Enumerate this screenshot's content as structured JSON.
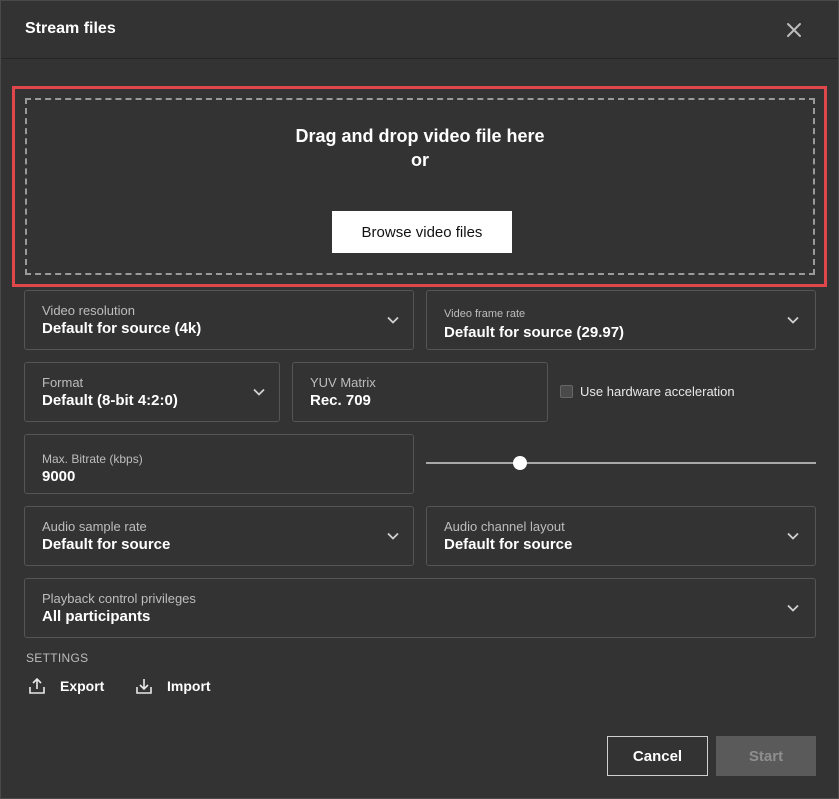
{
  "dialog": {
    "title": "Stream files"
  },
  "dropzone": {
    "main_text": "Drag and drop video file here",
    "or_text": "or",
    "browse_label": "Browse video files"
  },
  "fields": {
    "video_resolution": {
      "label": "Video resolution",
      "value": "Default for source (4k)"
    },
    "video_frame_rate": {
      "label": "Video frame rate",
      "value": "Default for source (29.97)"
    },
    "format": {
      "label": "Format",
      "value": "Default (8-bit 4:2:0)"
    },
    "yuv_matrix": {
      "label": "YUV Matrix",
      "value": "Rec. 709"
    },
    "hardware_acceleration": {
      "label": "Use hardware acceleration",
      "checked": false
    },
    "max_bitrate": {
      "label": "Max. Bitrate (kbps)",
      "value": "9000",
      "slider_fraction": 0.24
    },
    "audio_sample_rate": {
      "label": "Audio sample rate",
      "value": "Default for source"
    },
    "audio_channel_layout": {
      "label": "Audio channel layout",
      "value": "Default for source"
    },
    "playback_control": {
      "label": "Playback control privileges",
      "value": "All participants"
    }
  },
  "settings": {
    "title": "SETTINGS",
    "export_label": "Export",
    "import_label": "Import"
  },
  "footer": {
    "cancel_label": "Cancel",
    "start_label": "Start"
  },
  "icons": {
    "close": "close-icon",
    "chevron": "chevron-down-icon",
    "export": "export-icon",
    "import": "import-icon"
  },
  "colors": {
    "highlight": "#e0474c",
    "background": "#333333",
    "field_border": "#555555"
  }
}
